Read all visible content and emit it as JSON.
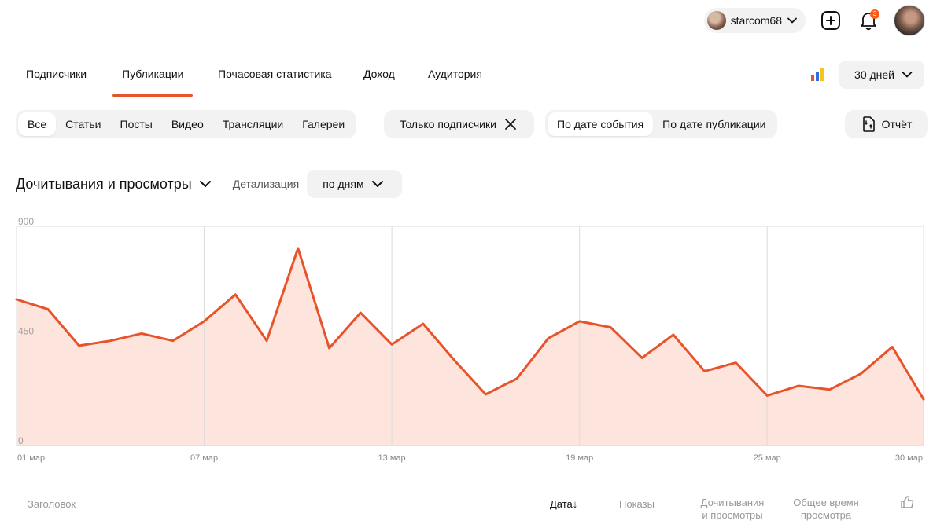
{
  "header": {
    "username": "starcom68",
    "notification_count": "3",
    "icons": {
      "user_dropdown": "chevron-down-icon",
      "create": "plus-square-icon",
      "notifications": "bell-icon",
      "avatar": "avatar"
    }
  },
  "nav": {
    "tabs": [
      {
        "label": "Подписчики"
      },
      {
        "label": "Публикации",
        "active": true
      },
      {
        "label": "Почасовая статистика"
      },
      {
        "label": "Доход"
      },
      {
        "label": "Аудитория"
      }
    ],
    "period_label": "30 дней"
  },
  "filters": {
    "types": [
      "Все",
      "Статьи",
      "Посты",
      "Видео",
      "Трансляции",
      "Галереи"
    ],
    "active_type": "Все",
    "subscribers_only": "Только подписчики",
    "date_modes": [
      "По дате события",
      "По дате публикации"
    ],
    "active_date_mode": "По дате события",
    "report_label": "Отчёт"
  },
  "chart_header": {
    "metric": "Дочитывания и просмотры",
    "detail_label": "Детализация",
    "detail_value": "по дням"
  },
  "colors": {
    "accent": "#e8532a",
    "area_fill": "#fde4dc",
    "grid": "#dcdcdc"
  },
  "chart_data": {
    "type": "area",
    "x": [
      "01 мар",
      "02 мар",
      "03 мар",
      "04 мар",
      "05 мар",
      "06 мар",
      "07 мар",
      "08 мар",
      "09 мар",
      "10 мар",
      "11 мар",
      "12 мар",
      "13 мар",
      "14 мар",
      "15 мар",
      "16 мар",
      "17 мар",
      "18 мар",
      "19 мар",
      "20 мар",
      "21 мар",
      "22 мар",
      "23 мар",
      "24 мар",
      "25 мар",
      "26 мар",
      "27 мар",
      "28 мар",
      "29 мар",
      "30 мар"
    ],
    "values": [
      600,
      560,
      410,
      430,
      460,
      430,
      510,
      620,
      430,
      810,
      400,
      545,
      415,
      500,
      350,
      210,
      275,
      440,
      510,
      485,
      360,
      455,
      305,
      340,
      205,
      245,
      230,
      295,
      405,
      190
    ],
    "xticks": [
      "01 мар",
      "07 мар",
      "13 мар",
      "19 мар",
      "25 мар",
      "30 мар"
    ],
    "yticks": [
      0,
      450,
      900
    ],
    "ylim": [
      0,
      900
    ],
    "grid": true,
    "title": "",
    "xlabel": "",
    "ylabel": ""
  },
  "table": {
    "columns": {
      "title": "Заголовок",
      "date": "Дата",
      "date_sort": "↓",
      "impressions": "Показы",
      "reads_line1": "Дочитывания",
      "reads_line2": "и просмотры",
      "time_line1": "Общее время",
      "time_line2": "просмотра"
    }
  }
}
